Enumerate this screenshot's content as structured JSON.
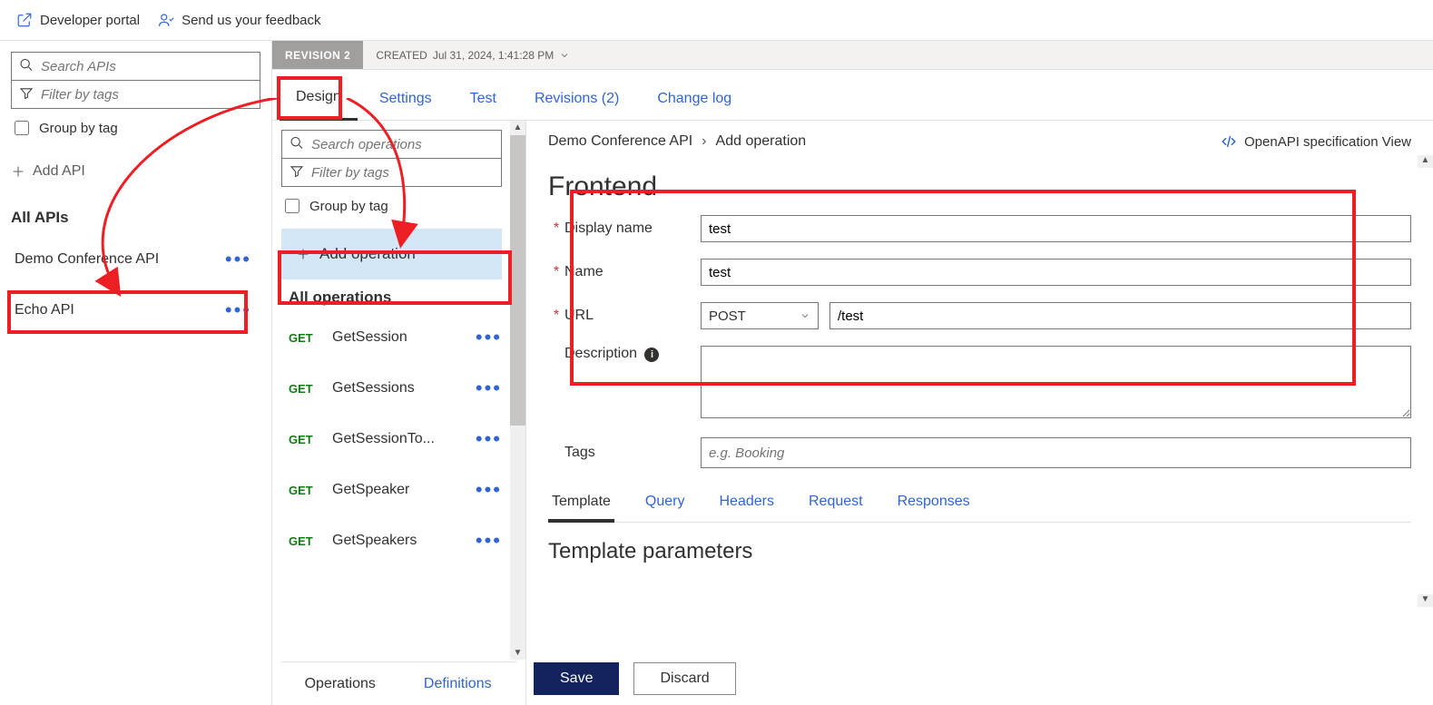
{
  "topbar": {
    "devportal": "Developer portal",
    "feedback": "Send us your feedback"
  },
  "apis_panel": {
    "search_ph": "Search APIs",
    "filter_ph": "Filter by tags",
    "group": "Group by tag",
    "add": "Add API",
    "header": "All APIs",
    "items": [
      {
        "name": "Demo Conference API",
        "selected": true
      },
      {
        "name": "Echo API",
        "selected": false
      }
    ]
  },
  "revision": {
    "badge": "REVISION 2",
    "created_label": "CREATED",
    "created_value": "Jul 31, 2024, 1:41:28 PM"
  },
  "design_tabs": [
    "Design",
    "Settings",
    "Test",
    "Revisions (2)",
    "Change log"
  ],
  "design_tab_active": 0,
  "ops_panel": {
    "search_ph": "Search operations",
    "filter_ph": "Filter by tags",
    "group": "Group by tag",
    "add": "Add operation",
    "header": "All operations",
    "items": [
      {
        "verb": "GET",
        "name": "GetSession"
      },
      {
        "verb": "GET",
        "name": "GetSessions"
      },
      {
        "verb": "GET",
        "name": "GetSessionTo..."
      },
      {
        "verb": "GET",
        "name": "GetSpeaker"
      },
      {
        "verb": "GET",
        "name": "GetSpeakers"
      }
    ],
    "bottom_tabs": [
      "Operations",
      "Definitions"
    ],
    "bottom_active": 0
  },
  "editor": {
    "breadcrumb": [
      "Demo Conference API",
      "Add operation"
    ],
    "openapi": "OpenAPI specification View",
    "frontend": "Frontend",
    "labels": {
      "display_name": "Display name",
      "name": "Name",
      "url": "URL",
      "description": "Description",
      "tags": "Tags"
    },
    "values": {
      "display_name": "test",
      "name": "test",
      "method": "POST",
      "url": "/test",
      "description": "",
      "tags_ph": "e.g. Booking"
    },
    "param_tabs": [
      "Template",
      "Query",
      "Headers",
      "Request",
      "Responses"
    ],
    "param_active": 0,
    "template_header": "Template parameters",
    "save": "Save",
    "discard": "Discard"
  }
}
